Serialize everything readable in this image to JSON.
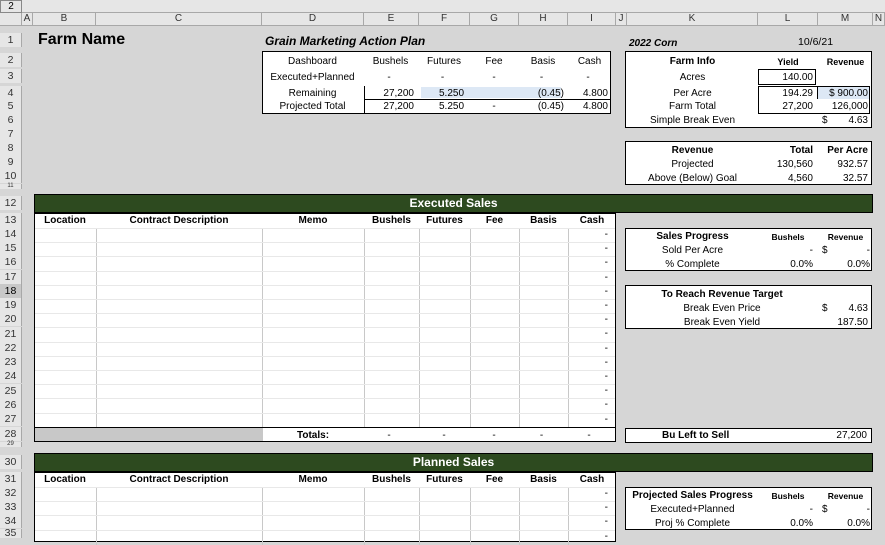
{
  "cell_ref": "2",
  "columns": [
    "A",
    "B",
    "C",
    "D",
    "E",
    "F",
    "G",
    "H",
    "I",
    "J",
    "K",
    "L",
    "M",
    "N"
  ],
  "rows": [
    "1",
    "2",
    "3",
    "4",
    "5",
    "6",
    "7",
    "8",
    "9",
    "10",
    "11",
    "12",
    "13",
    "14",
    "15",
    "16",
    "17",
    "18",
    "19",
    "20",
    "21",
    "22",
    "23",
    "24",
    "25",
    "26",
    "27",
    "28",
    "29",
    "30",
    "31",
    "32",
    "33",
    "34",
    "35"
  ],
  "title": "Farm Name",
  "plan_title": "Grain Marketing Action Plan",
  "crop": "2022 Corn",
  "date": "10/6/21",
  "dashboard": {
    "headers": [
      "Dashboard",
      "Bushels",
      "Futures",
      "Fee",
      "Basis",
      "Cash"
    ],
    "rows": [
      [
        "Executed+Planned",
        "-",
        "-",
        "-",
        "-",
        "-"
      ],
      [
        "Remaining",
        "27,200",
        "5.250",
        "",
        "(0.45)",
        "4.800"
      ],
      [
        "Projected Total",
        "27,200",
        "5.250",
        "-",
        "(0.45)",
        "4.800"
      ]
    ]
  },
  "farm_info": {
    "title": "Farm Info",
    "yield_hdr": "Yield",
    "revenue_hdr": "Revenue",
    "rows": [
      [
        "Acres",
        "140.00",
        ""
      ],
      [
        "Per Acre",
        "194.29",
        "$ 900.00"
      ],
      [
        "Farm Total",
        "27,200",
        "126,000"
      ],
      [
        "Simple Break Even",
        "",
        "$",
        "4.63"
      ]
    ]
  },
  "revenue": {
    "headers": [
      "Revenue",
      "Total",
      "Per Acre"
    ],
    "rows": [
      [
        "Projected",
        "130,560",
        "932.57"
      ],
      [
        "Above (Below) Goal",
        "4,560",
        "32.57"
      ]
    ]
  },
  "executed": {
    "banner": "Executed Sales",
    "headers": [
      "Location",
      "Contract Description",
      "Memo",
      "Bushels",
      "Futures",
      "Fee",
      "Basis",
      "Cash"
    ],
    "totals_label": "Totals:",
    "totals": [
      "-",
      "-",
      "-",
      "-",
      "-"
    ]
  },
  "sales_progress": {
    "headers": [
      "Sales Progress",
      "Bushels",
      "Revenue"
    ],
    "rows": [
      [
        "Sold Per Acre",
        "-",
        "$",
        "-"
      ],
      [
        "% Complete",
        "0.0%",
        "",
        "0.0%"
      ]
    ]
  },
  "reach_target": {
    "title": "To Reach Revenue Target",
    "rows": [
      [
        "Break Even Price",
        "$",
        "4.63"
      ],
      [
        "Break Even Yield",
        "",
        "187.50"
      ]
    ]
  },
  "bu_left": {
    "label": "Bu Left to Sell",
    "value": "27,200"
  },
  "planned": {
    "banner": "Planned Sales",
    "headers": [
      "Location",
      "Contract Description",
      "Memo",
      "Bushels",
      "Futures",
      "Fee",
      "Basis",
      "Cash"
    ]
  },
  "proj_progress": {
    "headers": [
      "Projected Sales Progress",
      "Bushels",
      "Revenue"
    ],
    "rows": [
      [
        "Executed+Planned",
        "-",
        "$",
        "-"
      ],
      [
        "Proj % Complete",
        "0.0%",
        "",
        "0.0%"
      ]
    ]
  },
  "colors": {
    "banner": "#2d4a1f",
    "highlight": "#dde8f5",
    "selected_row": "#c8c8c8"
  }
}
